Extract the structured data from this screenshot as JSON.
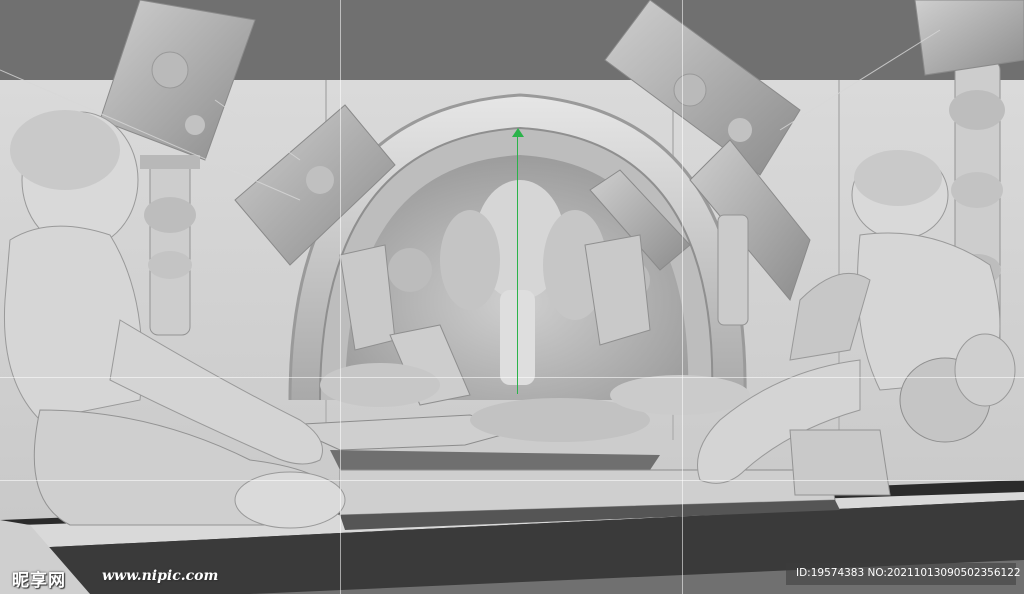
{
  "watermark": {
    "logo": "昵享网",
    "url": "www.nipic.com",
    "id_line": "ID:19574383 NO:20211013090502356122"
  },
  "scene": {
    "description_label": "",
    "axis_color": "#2bb34a",
    "background_color": "#707070",
    "model_color": "#d2d2d2"
  }
}
